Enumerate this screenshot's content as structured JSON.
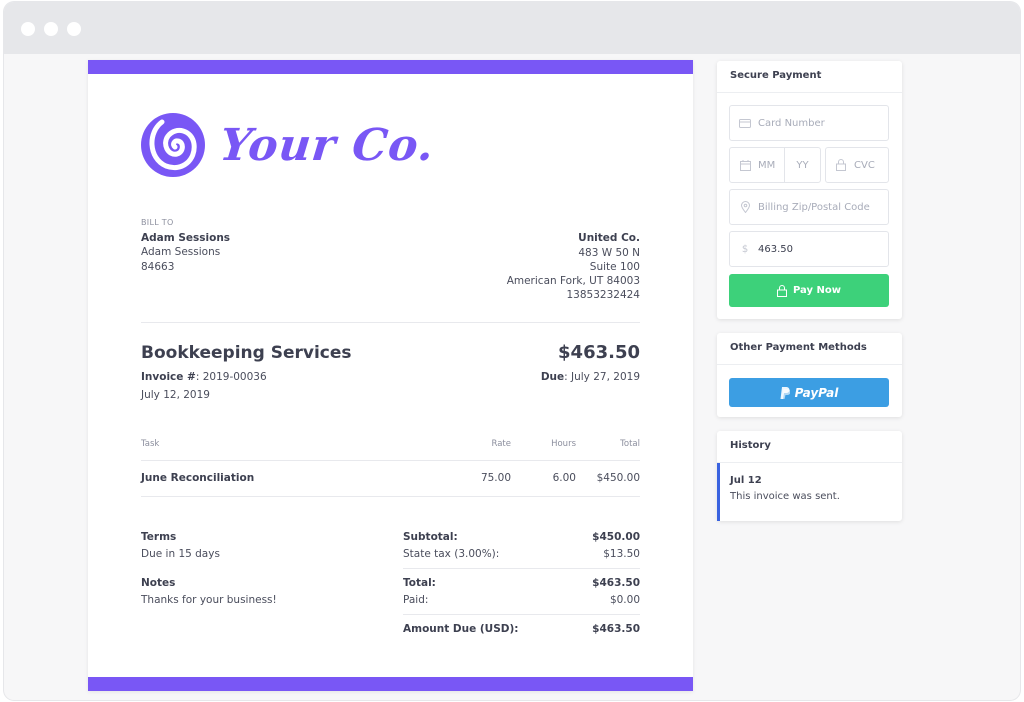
{
  "window": {
    "controls": [
      "close",
      "minimize",
      "maximize"
    ]
  },
  "brand": {
    "name": "Your Co.",
    "color": "#7957f5"
  },
  "bill_to": {
    "label": "BILL TO",
    "name": "Adam Sessions",
    "line1": "Adam Sessions",
    "line2": "84663"
  },
  "from": {
    "company": "United Co.",
    "address1": "483 W 50 N",
    "address2": "Suite 100",
    "city": "American Fork, UT 84003",
    "phone": "13853232424"
  },
  "invoice": {
    "title": "Bookkeeping Services",
    "amount": "$463.50",
    "number_label": "Invoice #",
    "number": ": 2019-00036",
    "date": "July 12, 2019",
    "due_label": "Due",
    "due_date": ": July 27, 2019"
  },
  "table": {
    "headers": {
      "task": "Task",
      "rate": "Rate",
      "hours": "Hours",
      "total": "Total"
    },
    "rows": [
      {
        "task": "June Reconciliation",
        "rate": "75.00",
        "hours": "6.00",
        "total": "$450.00"
      }
    ]
  },
  "terms": {
    "label": "Terms",
    "value": "Due in 15 days"
  },
  "notes": {
    "label": "Notes",
    "value": "Thanks for your business!"
  },
  "totals": {
    "subtotal_label": "Subtotal:",
    "subtotal": "$450.00",
    "tax_label": "State tax (3.00%):",
    "tax": "$13.50",
    "total_label": "Total:",
    "total": "$463.50",
    "paid_label": "Paid:",
    "paid": "$0.00",
    "due_label": "Amount Due (USD):",
    "due": "$463.50"
  },
  "payment": {
    "title": "Secure Payment",
    "card_placeholder": "Card Number",
    "mm_placeholder": "MM",
    "yy_placeholder": "YY",
    "cvc_placeholder": "CVC",
    "zip_placeholder": "Billing Zip/Postal Code",
    "amount_value": "463.50",
    "currency_symbol": "$",
    "pay_label": "Pay Now",
    "pay_color": "#3dd17a"
  },
  "other_methods": {
    "title": "Other Payment Methods",
    "paypal_label": "PayPal",
    "paypal_color": "#3c9ee3"
  },
  "history": {
    "title": "History",
    "items": [
      {
        "date": "Jul 12",
        "text": "This invoice was sent."
      }
    ]
  }
}
